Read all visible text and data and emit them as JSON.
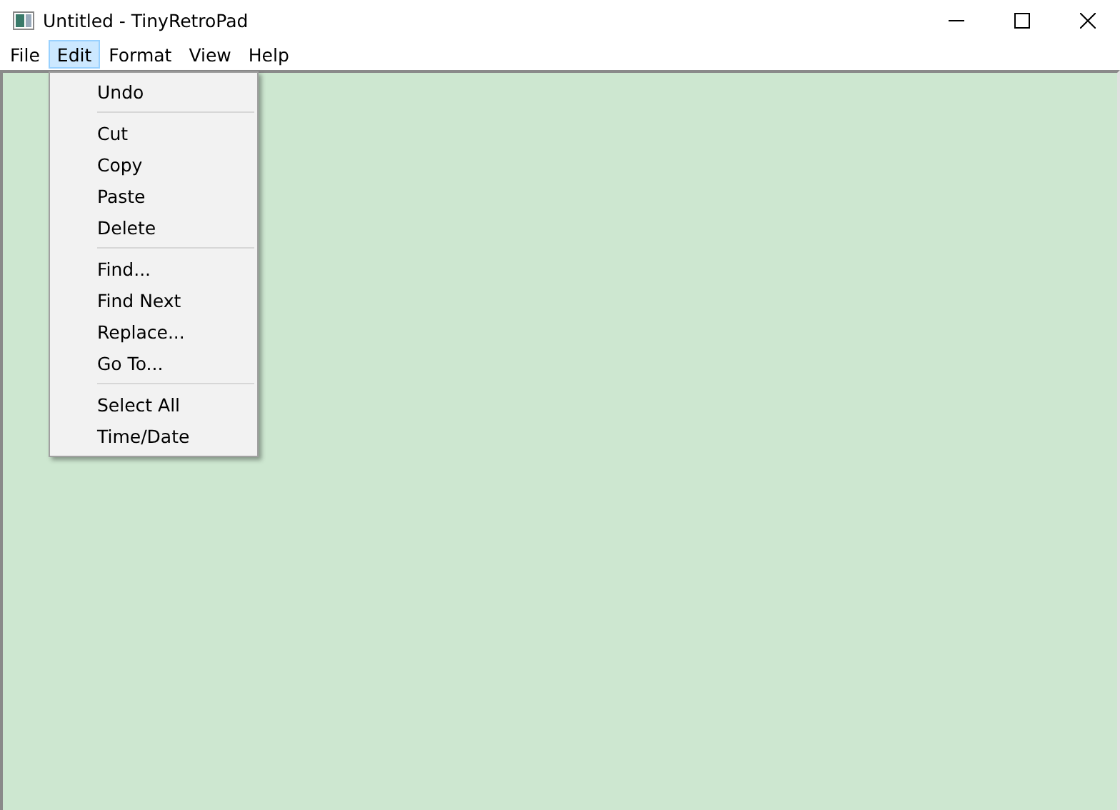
{
  "window": {
    "title": "Untitled - TinyRetroPad"
  },
  "menu_bar": [
    {
      "label": "File",
      "selected": false
    },
    {
      "label": "Edit",
      "selected": true
    },
    {
      "label": "Format",
      "selected": false
    },
    {
      "label": "View",
      "selected": false
    },
    {
      "label": "Help",
      "selected": false
    }
  ],
  "edit_menu": [
    {
      "kind": "item",
      "label": "Undo"
    },
    {
      "kind": "separator"
    },
    {
      "kind": "item",
      "label": "Cut"
    },
    {
      "kind": "item",
      "label": "Copy"
    },
    {
      "kind": "item",
      "label": "Paste"
    },
    {
      "kind": "item",
      "label": "Delete"
    },
    {
      "kind": "separator"
    },
    {
      "kind": "item",
      "label": "Find..."
    },
    {
      "kind": "item",
      "label": "Find Next"
    },
    {
      "kind": "item",
      "label": "Replace..."
    },
    {
      "kind": "item",
      "label": "Go To..."
    },
    {
      "kind": "separator"
    },
    {
      "kind": "item",
      "label": "Select All"
    },
    {
      "kind": "item",
      "label": "Time/Date"
    }
  ]
}
